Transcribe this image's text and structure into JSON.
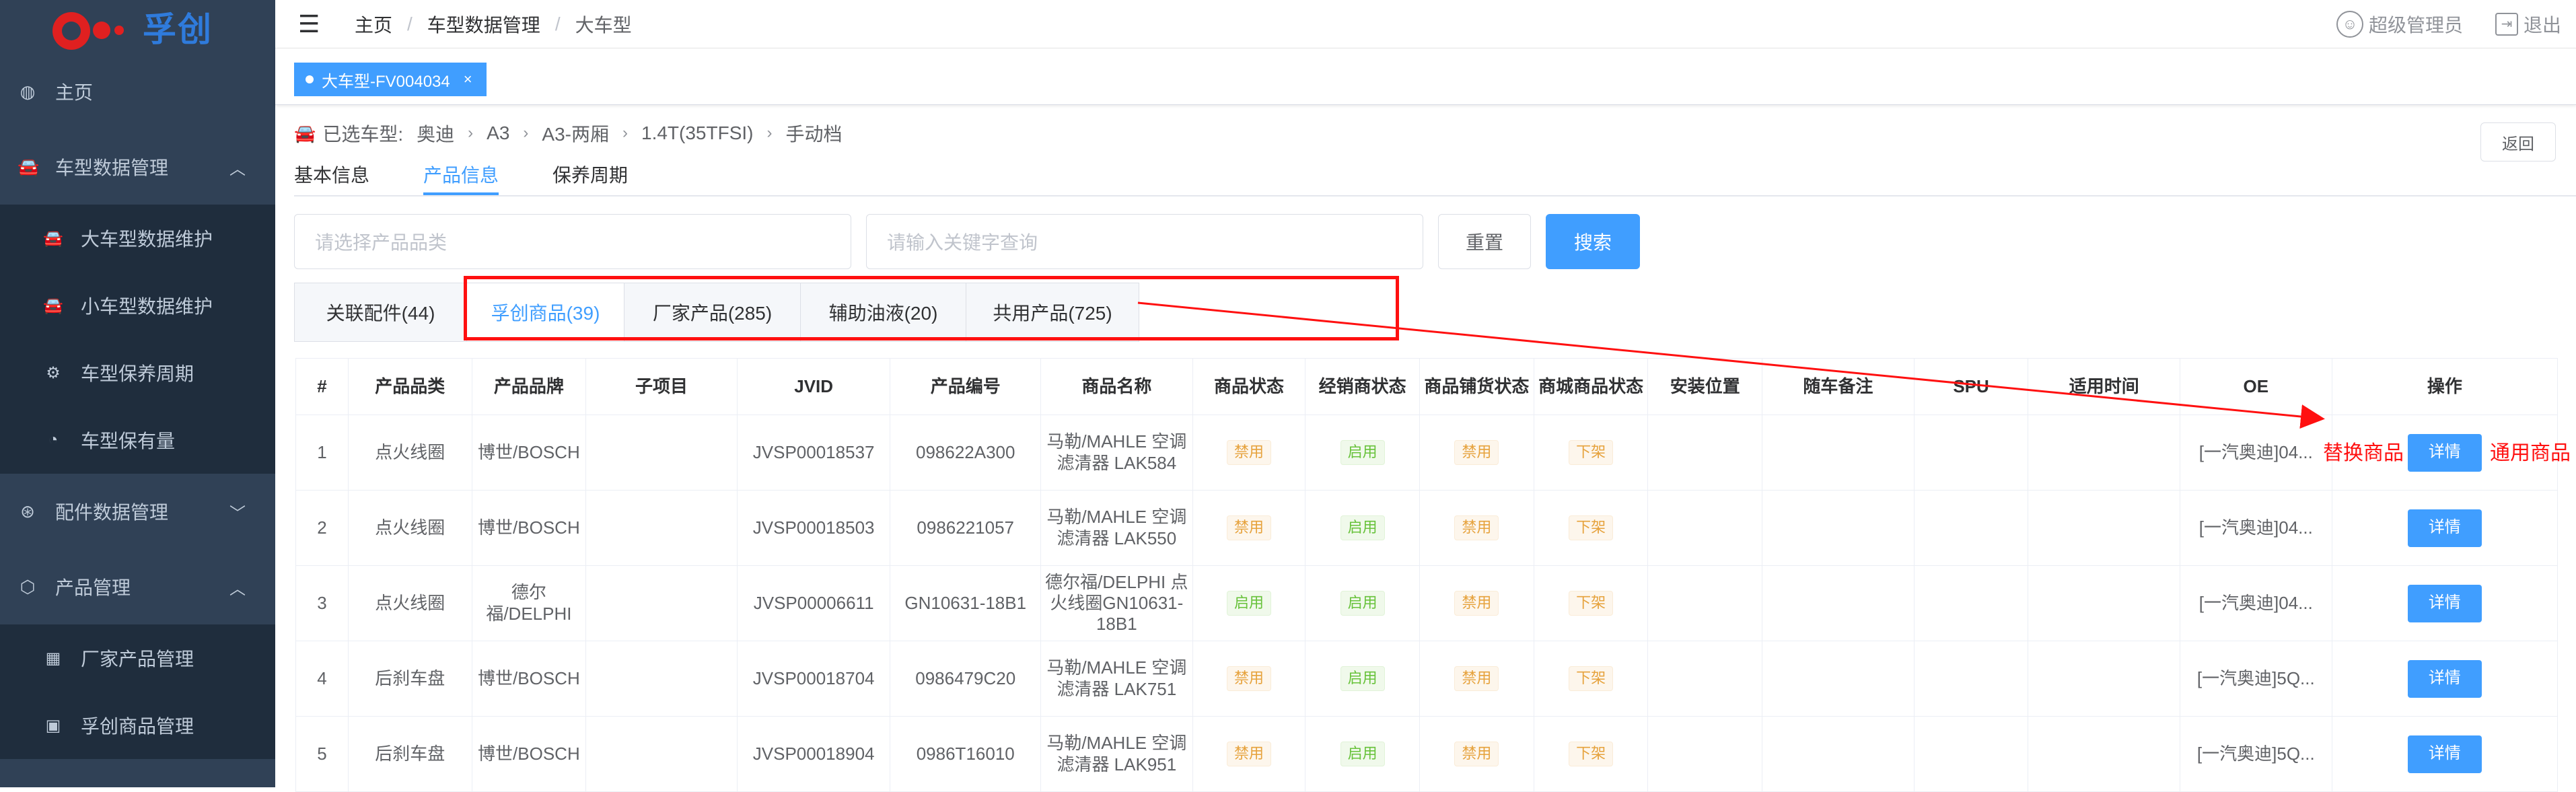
{
  "brand": {
    "logo_text": "孚创"
  },
  "sidebar": {
    "items": [
      {
        "label": "主页",
        "icon": "dashboard-icon",
        "glyph": "◍"
      },
      {
        "label": "车型数据管理",
        "icon": "car-icon",
        "glyph": "🚘",
        "expanded": true,
        "children": [
          {
            "label": "大车型数据维护",
            "icon": "car-icon",
            "glyph": "🚘"
          },
          {
            "label": "小车型数据维护",
            "icon": "car-icon",
            "glyph": "🚘"
          },
          {
            "label": "车型保养周期",
            "icon": "cycle-icon",
            "glyph": "⚙"
          },
          {
            "label": "车型保有量",
            "icon": "pie-chart-icon",
            "glyph": "◔"
          }
        ]
      },
      {
        "label": "配件数据管理",
        "icon": "parts-icon",
        "glyph": "⊛",
        "expanded": false
      },
      {
        "label": "产品管理",
        "icon": "cube-icon",
        "glyph": "⬡",
        "expanded": true,
        "children": [
          {
            "label": "厂家产品管理",
            "icon": "grid-icon",
            "glyph": "▦"
          },
          {
            "label": "孚创商品管理",
            "icon": "grid-outline-icon",
            "glyph": "▣"
          }
        ]
      }
    ]
  },
  "header": {
    "breadcrumb": [
      "主页",
      "车型数据管理",
      "大车型"
    ],
    "user_label": "超级管理员",
    "logout_label": "退出"
  },
  "tags": [
    {
      "label": "大车型-FV004034"
    }
  ],
  "selected_car": {
    "prefix": "已选车型:",
    "path": [
      "奥迪",
      "A3",
      "A3-两厢",
      "1.4T(35TFSI)",
      "手动档"
    ]
  },
  "back_label": "返回",
  "page_tabs": [
    {
      "label": "基本信息",
      "active": false
    },
    {
      "label": "产品信息",
      "active": true
    },
    {
      "label": "保养周期",
      "active": false
    }
  ],
  "filter": {
    "category_placeholder": "请选择产品品类",
    "keyword_placeholder": "请输入关键字查询",
    "reset_label": "重置",
    "search_label": "搜索"
  },
  "category_tabs": [
    {
      "label": "关联配件(44)",
      "active": false
    },
    {
      "label": "孚创商品(39)",
      "active": true
    },
    {
      "label": "厂家产品(285)",
      "active": false
    },
    {
      "label": "辅助油液(20)",
      "active": false
    },
    {
      "label": "共用产品(725)",
      "active": false
    }
  ],
  "table": {
    "headers": [
      "#",
      "产品品类",
      "产品品牌",
      "子项目",
      "JVID",
      "产品编号",
      "商品名称",
      "商品状态",
      "经销商状态",
      "商品铺货状态",
      "商城商品状态",
      "安装位置",
      "随车备注",
      "SPU",
      "适用时间",
      "OE",
      "操作"
    ],
    "detail_label": "详情",
    "rows": [
      {
        "no": "1",
        "category": "点火线圈",
        "brand": "博世/BOSCH",
        "sub": "",
        "jvid": "JVSP00018537",
        "code": "098622A300",
        "name": "马勒/MAHLE 空调滤清器 LAK584",
        "s1": "禁用",
        "s2": "启用",
        "s3": "禁用",
        "s4": "下架",
        "pos": "",
        "note": "",
        "spu": "",
        "time": "",
        "oe": "[一汽奥迪]04..."
      },
      {
        "no": "2",
        "category": "点火线圈",
        "brand": "博世/BOSCH",
        "sub": "",
        "jvid": "JVSP00018503",
        "code": "0986221057",
        "name": "马勒/MAHLE 空调滤清器 LAK550",
        "s1": "禁用",
        "s2": "启用",
        "s3": "禁用",
        "s4": "下架",
        "pos": "",
        "note": "",
        "spu": "",
        "time": "",
        "oe": "[一汽奥迪]04..."
      },
      {
        "no": "3",
        "category": "点火线圈",
        "brand": "德尔福/DELPHI",
        "sub": "",
        "jvid": "JVSP00006611",
        "code": "GN10631-18B1",
        "name": "德尔福/DELPHI 点火线圈GN10631-18B1",
        "s1": "启用",
        "s2": "启用",
        "s3": "禁用",
        "s4": "下架",
        "pos": "",
        "note": "",
        "spu": "",
        "time": "",
        "oe": "[一汽奥迪]04..."
      },
      {
        "no": "4",
        "category": "后刹车盘",
        "brand": "博世/BOSCH",
        "sub": "",
        "jvid": "JVSP00018704",
        "code": "0986479C20",
        "name": "马勒/MAHLE 空调滤清器 LAK751",
        "s1": "禁用",
        "s2": "启用",
        "s3": "禁用",
        "s4": "下架",
        "pos": "",
        "note": "",
        "spu": "",
        "time": "",
        "oe": "[一汽奥迪]5Q..."
      },
      {
        "no": "5",
        "category": "后刹车盘",
        "brand": "博世/BOSCH",
        "sub": "",
        "jvid": "JVSP00018904",
        "code": "0986T16010",
        "name": "马勒/MAHLE 空调滤清器 LAK951",
        "s1": "禁用",
        "s2": "启用",
        "s3": "禁用",
        "s4": "下架",
        "pos": "",
        "note": "",
        "spu": "",
        "time": "",
        "oe": "[一汽奥迪]5Q..."
      }
    ]
  },
  "annotations": {
    "left": "替换商品",
    "right": "通用商品"
  },
  "colors": {
    "sidebar_bg": "#304156",
    "primary": "#409eff",
    "annotation_red": "#ff1010",
    "enabled_green": "#67c23a",
    "disabled_orange": "#e6a23c"
  }
}
